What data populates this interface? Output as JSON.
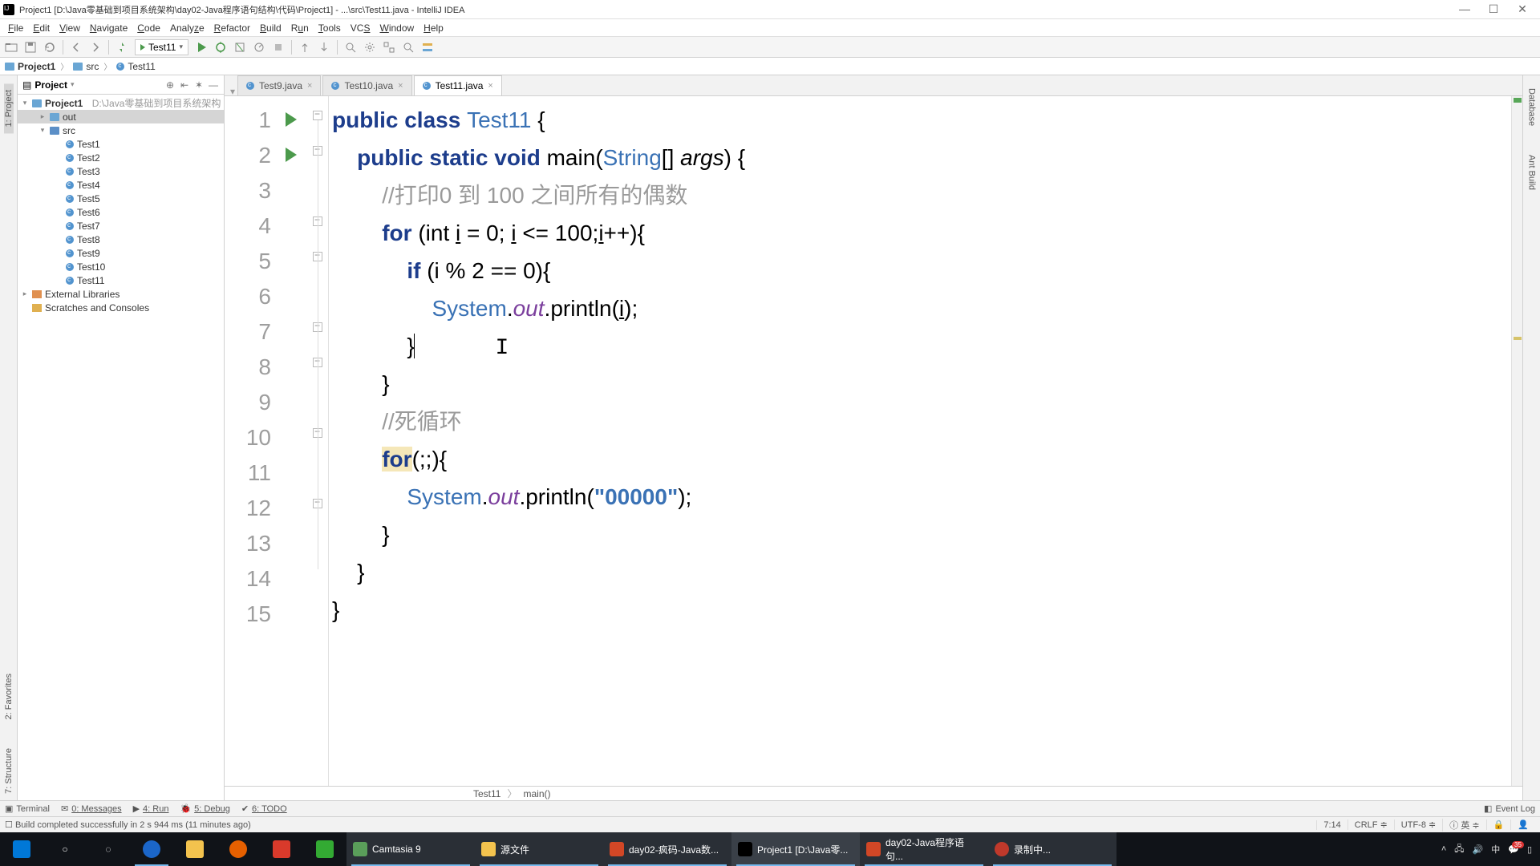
{
  "title": "Project1 [D:\\Java零基础到项目系统架构\\day02-Java程序语句结构\\代码\\Project1] - ...\\src\\Test11.java - IntelliJ IDEA",
  "menu": [
    "File",
    "Edit",
    "View",
    "Navigate",
    "Code",
    "Analyze",
    "Refactor",
    "Build",
    "Run",
    "Tools",
    "VCS",
    "Window",
    "Help"
  ],
  "run_config": "Test11",
  "breadcrumb": {
    "project": "Project1",
    "folder": "src",
    "file": "Test11"
  },
  "project_panel": {
    "title": "Project",
    "root": {
      "name": "Project1",
      "hint": "D:\\Java零基础到项目系统架构"
    },
    "folders": [
      "out",
      "src"
    ],
    "files": [
      "Test1",
      "Test2",
      "Test3",
      "Test4",
      "Test5",
      "Test6",
      "Test7",
      "Test8",
      "Test9",
      "Test10",
      "Test11"
    ],
    "extra": [
      "External Libraries",
      "Scratches and Consoles"
    ]
  },
  "tabs": [
    {
      "label": "Test9.java",
      "active": false
    },
    {
      "label": "Test10.java",
      "active": false
    },
    {
      "label": "Test11.java",
      "active": true
    }
  ],
  "code_lines": [
    1,
    2,
    3,
    4,
    5,
    6,
    7,
    8,
    9,
    10,
    11,
    12,
    13,
    14,
    15
  ],
  "code": {
    "class_kw": "public class ",
    "class_name": "Test11",
    "brace_open": " {",
    "main_sig_pre": "    public static void ",
    "main_name": "main",
    "main_paren": "(",
    "string_type": "String",
    "array": "[] ",
    "args": "args",
    "main_close": ") {",
    "comment1": "        //打印0 到 100 之间所有的偶数",
    "for1_pre": "        for ",
    "for1_paren": "(int ",
    "for1_var": "i",
    "for1_mid": " = 0; ",
    "for1_var2": "i",
    "for1_cond": " <= 100;",
    "for1_inc": "i",
    "for1_end": "++){",
    "if_pre": "            if ",
    "if_cond": "(i % 2 == 0)",
    "if_brace": "{",
    "println1_indent": "                ",
    "system": "System",
    "dot": ".",
    "out": "out",
    "println": ".println(",
    "println1_arg": "i",
    "println_close": ");",
    "close_if": "            }",
    "close_for1": "        }",
    "comment2": "        //死循环",
    "for2_pre": "        ",
    "for2_kw": "for",
    "for2_rest": "(;;){",
    "println2_indent": "            ",
    "println2_str": "\"00000\"",
    "close_for2": "        }",
    "close_main": "    }",
    "close_class": "}"
  },
  "editor_breadcrumb": {
    "cls": "Test11",
    "m": "main()"
  },
  "tool_windows": [
    "Terminal",
    "0: Messages",
    "4: Run",
    "5: Debug",
    "6: TODO"
  ],
  "event_log": "Event Log",
  "status": {
    "msg": "Build completed successfully in 2 s 944 ms (11 minutes ago)",
    "pos": "7:14",
    "eol": "CRLF",
    "enc": "UTF-8",
    "lang": "英",
    "lock": "🔒"
  },
  "left_tabs": [
    "1: Project",
    "2: Favorites",
    "7: Structure"
  ],
  "right_tabs": [
    "Database",
    "Ant Build"
  ],
  "taskbar": {
    "apps": [
      "源文件",
      "day02-疯码-Java数...",
      "Project1 [D:\\Java零...",
      "day02-Java程序语句...",
      "录制中..."
    ]
  }
}
